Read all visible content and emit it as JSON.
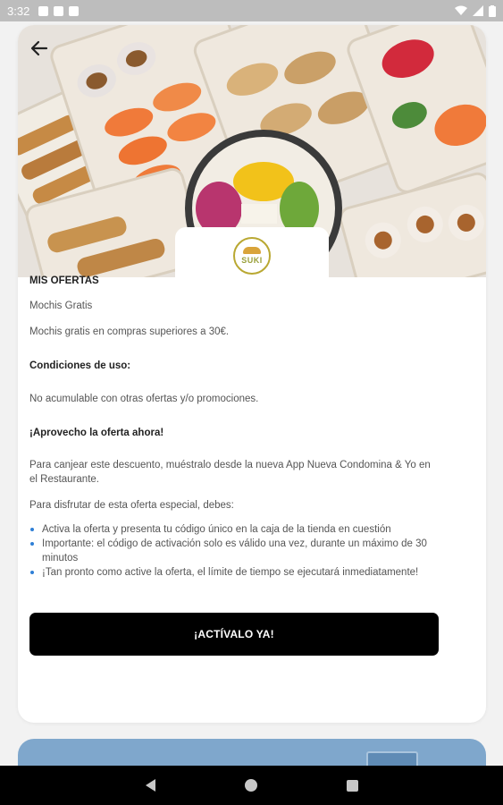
{
  "status_bar": {
    "time": "3:32"
  },
  "header": {
    "logo_text": "SUKI"
  },
  "offer": {
    "section_title": "MIS OFERTAS",
    "offer_name": "Mochis Gratis",
    "offer_description": "Mochis gratis en compras superiores a 30€.",
    "conditions_title": "Condiciones de uso:",
    "conditions_text": "No acumulable con otras ofertas y/o promociones.",
    "cta_heading": "¡Aprovecho la oferta ahora!",
    "redeem_text": "Para canjear este descuento, muéstralo desde la nueva App Nueva Condomina & Yo en el Restaurante.",
    "enjoy_intro": "Para disfrutar de esta oferta especial, debes:",
    "bullets": [
      "Activa la oferta y presenta tu código único en la caja de la tienda en cuestión",
      "Importante: el código de activación solo es válido una vez, durante un máximo de 30 minutos",
      "¡Tan pronto como active la oferta, el límite de tiempo se ejecutará inmediatamente!"
    ],
    "button_label": "¡ACTÍVALO YA!"
  },
  "icons": {
    "back": "arrow-left-icon",
    "nav_back": "triangle-back-icon",
    "nav_home": "circle-home-icon",
    "nav_recent": "square-recent-icon"
  },
  "colors": {
    "button_bg": "#000000",
    "bullet": "#2f7fd6",
    "logo": "#b9a832"
  }
}
